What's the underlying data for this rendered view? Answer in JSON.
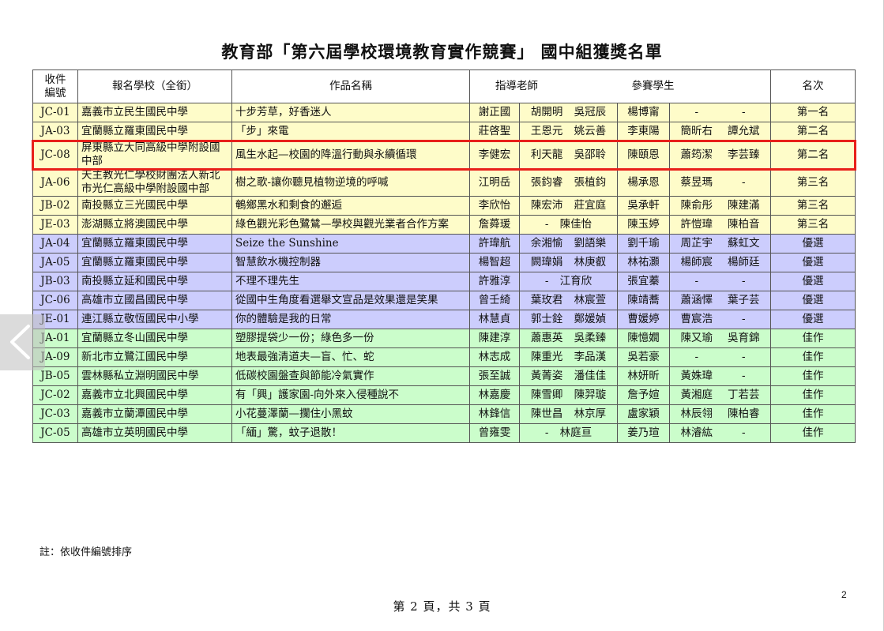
{
  "document": {
    "title": "教育部「第六屆學校環境教育實作競賽」 國中組獲獎名單",
    "header": {
      "code": "收件編號",
      "school": "報名學校（全銜）",
      "work": "作品名稱",
      "teacher": "指導老師",
      "students": "參賽學生",
      "rank": "名次"
    },
    "rows": [
      {
        "code": "JC-01",
        "school": "嘉義市立民生國民中學",
        "work": "十步芳草，好香迷人",
        "teachers": [
          "謝正國",
          "胡開明 吳冠辰"
        ],
        "students": [
          "楊博甯",
          "-",
          "-"
        ],
        "rank": "第一名"
      },
      {
        "code": "JA-03",
        "school": "宜蘭縣立羅東國民中學",
        "work": "「步」來電",
        "teachers": [
          "莊啓聖",
          "王恩元 姚云善"
        ],
        "students": [
          "李東陽",
          "簡昕右",
          "譚允斌"
        ],
        "rank": "第二名"
      },
      {
        "code": "JC-08",
        "school": "屏東縣立大同高級中學附設國中部",
        "work": "風生水起—校園的降溫行動與永續循環",
        "teachers": [
          "李健宏",
          "利天龍 吳邵聆"
        ],
        "students": [
          "陳頤恩",
          "蕭筠潔",
          "李芸臻"
        ],
        "rank": "第二名"
      },
      {
        "code": "JA-06",
        "school": "天主教光仁學校財團法人新北市光仁高級中學附設國中部",
        "work": "樹之歌-讓你聽見植物逆境的呼喊",
        "teachers": [
          "江明岳",
          "張鈞睿 張植鈞"
        ],
        "students": [
          "楊承恩",
          "蔡昱瑪",
          "-"
        ],
        "rank": "第三名"
      },
      {
        "code": "JB-02",
        "school": "南投縣立三光國民中學",
        "work": "鵪鄉黑水和剩食的邂逅",
        "teachers": [
          "李欣怡",
          "陳宏沛 莊宜庭"
        ],
        "students": [
          "吳承軒",
          "陳俞彤",
          "陳建滿"
        ],
        "rank": "第三名"
      },
      {
        "code": "JE-03",
        "school": "澎湖縣立將澳國民中學",
        "work": "綠色觀光彩色鷺鷥—學校與觀光業者合作方案",
        "teachers": [
          "詹蕣瑗",
          "- 陳佳怡"
        ],
        "students": [
          "陳玉婷",
          "許愷瑋",
          "陳柏音"
        ],
        "rank": "第三名"
      },
      {
        "code": "JA-04",
        "school": "宜蘭縣立羅東國民中學",
        "work": "Seize the Sunshine",
        "teachers": [
          "許瑋航",
          "余湘愉 劉語樂"
        ],
        "students": [
          "劉千瑜",
          "周芷宇",
          "蘇虹文"
        ],
        "rank": "優選"
      },
      {
        "code": "JA-05",
        "school": "宜蘭縣立羅東國民中學",
        "work": "智慧飲水機控制器",
        "teachers": [
          "楊智超",
          "闕瑋娟 林庚叡"
        ],
        "students": [
          "林祐灝",
          "楊師宸",
          "楊師廷"
        ],
        "rank": "優選"
      },
      {
        "code": "JB-03",
        "school": "南投縣立延和國民中學",
        "work": "不理不理先生",
        "teachers": [
          "許雅淳",
          "- 江育欣"
        ],
        "students": [
          "張宜蓁",
          "-",
          "-"
        ],
        "rank": "優選"
      },
      {
        "code": "JC-06",
        "school": "高雄市立國昌國民中學",
        "work": "從國中生角度看選舉文宣品是效果還是笑果",
        "teachers": [
          "曾壬綺",
          "葉玫君 林宸萱"
        ],
        "students": [
          "陳靖蕎",
          "蕭涵懌",
          "葉子芸"
        ],
        "rank": "優選"
      },
      {
        "code": "JE-01",
        "school": "連江縣立敬恆國民中小學",
        "work": "你的體驗是我的日常",
        "teachers": [
          "林慧貞",
          "郭士銓 鄭媛媜"
        ],
        "students": [
          "曹媛婷",
          "曹宸浩",
          "-"
        ],
        "rank": "優選"
      },
      {
        "code": "JA-01",
        "school": "宜蘭縣立冬山國民中學",
        "work": "塑膠提袋少一份；綠色多一份",
        "teachers": [
          "陳建淳",
          "蕭惠英 吳柔臻"
        ],
        "students": [
          "陳憶嫺",
          "陳又瑜",
          "吳育錦"
        ],
        "rank": "佳作"
      },
      {
        "code": "JA-09",
        "school": "新北市立鷺江國民中學",
        "work": "地表最強清道夫—盲、忙、蛇",
        "teachers": [
          "林志成",
          "陳重光 李品漢"
        ],
        "students": [
          "吳若豪",
          "-",
          "-"
        ],
        "rank": "佳作"
      },
      {
        "code": "JB-05",
        "school": "雲林縣私立淵明國民中學",
        "work": "低碳校園盤查與節能冷氣實作",
        "teachers": [
          "張至誠",
          "黃菁姿 潘佳佳"
        ],
        "students": [
          "林妍昕",
          "黃姝瑋",
          "-"
        ],
        "rank": "佳作"
      },
      {
        "code": "JC-02",
        "school": "嘉義市立北興國民中學",
        "work": "有「興」護家園-向外來入侵種說不",
        "teachers": [
          "林嘉慶",
          "陳雪卿 陳羿璇"
        ],
        "students": [
          "詹予媗",
          "黃湘庭",
          "丁若芸"
        ],
        "rank": "佳作"
      },
      {
        "code": "JC-03",
        "school": "嘉義市立蘭潭國民中學",
        "work": "小花蔓澤蘭—攔住小黑蚊",
        "teachers": [
          "林鋒信",
          "陳世昌 林京厚"
        ],
        "students": [
          "盧家穎",
          "林辰翎",
          "陳柏睿"
        ],
        "rank": "佳作"
      },
      {
        "code": "JC-05",
        "school": "高雄市立英明國民中學",
        "work": "「緬」驚，蚊子退散！",
        "teachers": [
          "曾雍雯",
          "- 林庭亘"
        ],
        "students": [
          "姜乃瑄",
          "林濬紘",
          "-"
        ],
        "rank": "佳作"
      }
    ],
    "note": "註：依收件編號排序",
    "footer": "第 2 頁，共 3 頁",
    "slide_number": "2"
  },
  "colors": {
    "first_group": "#fefcc9",
    "second_group": "#cccdfd",
    "third_group": "#cbfdcb",
    "highlight": "#e8201a"
  },
  "icons": {
    "prev": "chevron-left-icon"
  }
}
